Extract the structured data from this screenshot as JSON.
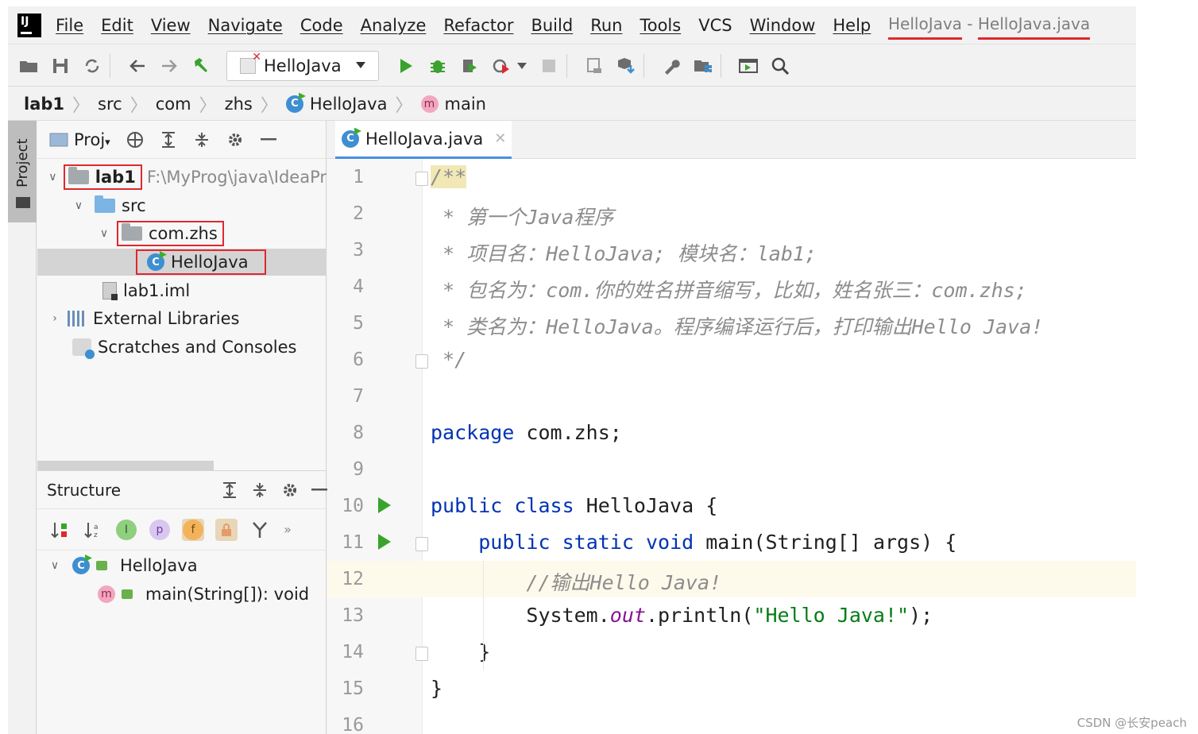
{
  "menu": {
    "items": [
      "File",
      "Edit",
      "View",
      "Navigate",
      "Code",
      "Analyze",
      "Refactor",
      "Build",
      "Run",
      "Tools",
      "VCS",
      "Window",
      "Help"
    ],
    "title_project": "HelloJava",
    "title_sep": " - ",
    "title_file": "HelloJava.java"
  },
  "toolbar": {
    "run_config": "HelloJava"
  },
  "breadcrumb": [
    "lab1",
    "src",
    "com",
    "zhs",
    "HelloJava",
    "main"
  ],
  "side_stripe": {
    "project_tab": "Project"
  },
  "project_panel": {
    "title": "Proj",
    "tree": {
      "root_name": "lab1",
      "root_path": "F:\\MyProg\\java\\IdeaPr",
      "src": "src",
      "package": "com.zhs",
      "class": "HelloJava",
      "iml": "lab1.iml",
      "ext_libs": "External Libraries",
      "scratches": "Scratches and Consoles"
    }
  },
  "structure_panel": {
    "title": "Structure",
    "badges": {
      "interface": "I",
      "property": "p",
      "field": "f"
    },
    "items": {
      "class": "HelloJava",
      "method": "main(String[]): void"
    }
  },
  "editor": {
    "tab_label": "HelloJava.java",
    "lines": {
      "l1": "/**",
      "l2": " * 第一个Java程序",
      "l3": " * 项目名：HelloJava; 模块名：lab1;",
      "l4": " * 包名为：com.你的姓名拼音缩写，比如，姓名张三：com.zhs;",
      "l5": " * 类名为：HelloJava。程序编译运行后，打印输出Hello Java!",
      "l6": " */",
      "l8_kw": "package",
      "l8_rest": " com.zhs;",
      "l10_kw1": "public",
      "l10_kw2": "class",
      "l10_rest": " HelloJava {",
      "l11_kw1": "public",
      "l11_kw2": "static",
      "l11_kw3": "void",
      "l11_rest": " main(String[] args) {",
      "l12": "//输出Hello Java!",
      "l13_a": "System.",
      "l13_field": "out",
      "l13_b": ".println(",
      "l13_str": "\"Hello Java!\"",
      "l13_c": ");",
      "l14": "}",
      "l15": "}"
    },
    "line_numbers": [
      "1",
      "2",
      "3",
      "4",
      "5",
      "6",
      "7",
      "8",
      "9",
      "10",
      "11",
      "12",
      "13",
      "14",
      "15",
      "16"
    ]
  },
  "watermark": "CSDN @长安peach",
  "colors": {
    "highlight_red": "#e0282e",
    "keyword": "#0033b3",
    "string": "#067d17",
    "run_green": "#3aa32e"
  }
}
